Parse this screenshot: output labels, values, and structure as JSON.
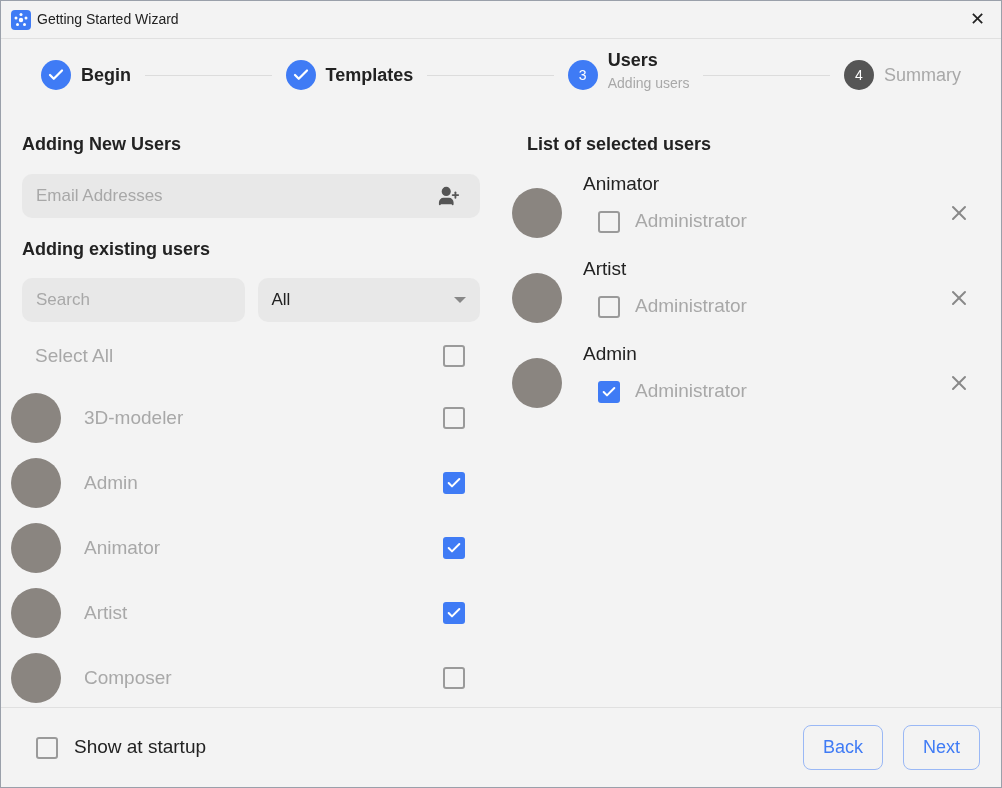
{
  "window": {
    "title": "Getting Started Wizard",
    "close": "✕"
  },
  "steps": [
    {
      "label": "Begin",
      "kind": "done"
    },
    {
      "label": "Templates",
      "kind": "done"
    },
    {
      "number": "3",
      "label": "Users",
      "subtitle": "Adding users",
      "kind": "current"
    },
    {
      "number": "4",
      "label": "Summary",
      "kind": "upcoming"
    }
  ],
  "new_users": {
    "heading": "Adding New Users",
    "email": {
      "placeholder": "Email Addresses"
    }
  },
  "existing_users": {
    "heading": "Adding existing users",
    "search": {
      "placeholder": "Search"
    },
    "filter": {
      "value": "All"
    },
    "select_all": {
      "label": "Select All",
      "checked": false
    },
    "users": [
      {
        "name": "3D-modeler",
        "checked": false
      },
      {
        "name": "Admin",
        "checked": true
      },
      {
        "name": "Animator",
        "checked": true
      },
      {
        "name": "Artist",
        "checked": true
      },
      {
        "name": "Composer",
        "checked": false
      }
    ]
  },
  "selected_users": {
    "heading": "List of selected users",
    "users": [
      {
        "name": "Animator",
        "role": "Administrator",
        "checked": false
      },
      {
        "name": "Artist",
        "role": "Administrator",
        "checked": false
      },
      {
        "name": "Admin",
        "role": "Administrator",
        "checked": true
      }
    ]
  },
  "footer": {
    "show_at_startup": {
      "label": "Show at startup",
      "checked": false
    },
    "buttons": [
      "Back",
      "Next"
    ]
  }
}
